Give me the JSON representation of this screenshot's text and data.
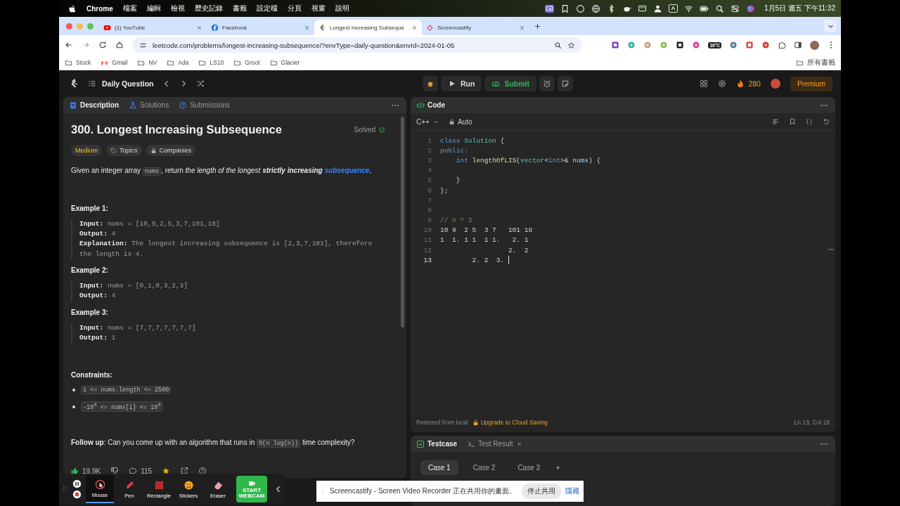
{
  "menubar": {
    "app": "Chrome",
    "menus": [
      "檔案",
      "編輯",
      "檢視",
      "歷史記錄",
      "書籤",
      "設定檔",
      "分頁",
      "視窗",
      "說明"
    ],
    "input_source": "A",
    "clock": "1月5日 週五  下午11:32"
  },
  "browser": {
    "tabs": [
      {
        "title": "(1) YouTube",
        "selected": false
      },
      {
        "title": "Facebook",
        "selected": false
      },
      {
        "title": "Longest Increasing Subseque",
        "selected": true
      },
      {
        "title": "Screencastify",
        "selected": false
      }
    ],
    "url": "leetcode.com/problems/longest-increasing-subsequence/?envType=daily-question&envId=2024-01-05",
    "weather_badge": "16°C",
    "bookmarks": [
      {
        "label": "Stock",
        "kind": "folder"
      },
      {
        "label": "Gmail",
        "kind": "mail"
      },
      {
        "label": "NV",
        "kind": "folder"
      },
      {
        "label": "Ada",
        "kind": "folder"
      },
      {
        "label": "LS10",
        "kind": "folder"
      },
      {
        "label": "Groot",
        "kind": "folder"
      },
      {
        "label": "Glacier",
        "kind": "folder"
      }
    ],
    "all_bookmarks": "所有書籤"
  },
  "header": {
    "list_title": "Daily Question",
    "run": "Run",
    "submit": "Submit",
    "streak": "280",
    "premium": "Premium"
  },
  "description": {
    "tabs": [
      {
        "label": "Description",
        "selected": true
      },
      {
        "label": "Solutions",
        "selected": false
      },
      {
        "label": "Submissions",
        "selected": false
      }
    ],
    "title": "300. Longest Increasing Subsequence",
    "status": "Solved",
    "tags": [
      {
        "label": "Medium",
        "kind": "difficulty"
      },
      {
        "label": "Topics",
        "kind": "topics"
      },
      {
        "label": "Companies",
        "kind": "companies"
      }
    ],
    "statement": [
      {
        "kind": "text",
        "text": "Given an integer array "
      },
      {
        "kind": "code",
        "text": "nums"
      },
      {
        "kind": "text",
        "text": ", return "
      },
      {
        "kind": "italic",
        "text": "the length of the longest "
      },
      {
        "kind": "bold_italic",
        "text": "strictly increasing "
      },
      {
        "kind": "link",
        "text": "subsequence"
      },
      {
        "kind": "text",
        "text": "."
      }
    ],
    "examples": [
      {
        "heading": "Example 1:",
        "lines": [
          {
            "label": "Input:",
            "value": "nums = [10,9,2,5,3,7,101,18]"
          },
          {
            "label": "Output:",
            "value": "4"
          },
          {
            "label": "Explanation:",
            "value": "The longest increasing subsequence is [2,3,7,101], therefore the length is 4."
          }
        ]
      },
      {
        "heading": "Example 2:",
        "lines": [
          {
            "label": "Input:",
            "value": "nums = [0,1,0,3,2,3]"
          },
          {
            "label": "Output:",
            "value": "4"
          }
        ]
      },
      {
        "heading": "Example 3:",
        "lines": [
          {
            "label": "Input:",
            "value": "nums = [7,7,7,7,7,7,7]"
          },
          {
            "label": "Output:",
            "value": "1"
          }
        ]
      }
    ],
    "constraints_heading": "Constraints:",
    "constraints": [
      "1 <= nums.length <= 2500",
      "-10$^{4}$ <= nums[i] <= 10$^{4}$"
    ],
    "follow_up": [
      {
        "kind": "bold",
        "text": "Follow up"
      },
      {
        "kind": "text",
        "text": ": Can you come up with an algorithm that runs in "
      },
      {
        "kind": "code",
        "text": "O(n log(n))"
      },
      {
        "kind": "text",
        "text": " time complexity?"
      }
    ],
    "likes": "19.9K",
    "comments": "115"
  },
  "code": {
    "title": "Code",
    "language": "C++",
    "mode": "Auto",
    "lines": [
      {
        "number": "1",
        "current": false,
        "tokens": [
          {
            "kind": "keyword",
            "text": "class"
          },
          {
            "kind": "type",
            "text": " Solution"
          },
          {
            "kind": "plain",
            "text": " {"
          }
        ]
      },
      {
        "number": "2",
        "current": false,
        "tokens": [
          {
            "kind": "keyword",
            "text": "public:"
          }
        ]
      },
      {
        "number": "3",
        "current": false,
        "tokens": [
          {
            "kind": "keyword",
            "text": "    int"
          },
          {
            "kind": "function",
            "text": " lengthOfLIS"
          },
          {
            "kind": "plain",
            "text": "("
          },
          {
            "kind": "type",
            "text": "vector"
          },
          {
            "kind": "plain",
            "text": "<"
          },
          {
            "kind": "keyword",
            "text": "int"
          },
          {
            "kind": "plain",
            "text": ">&"
          },
          {
            "kind": "variable",
            "text": " nums"
          },
          {
            "kind": "plain",
            "text": ") {"
          }
        ]
      },
      {
        "number": "4",
        "current": false
      },
      {
        "number": "5",
        "current": false,
        "tokens": [
          {
            "kind": "plain",
            "text": "    }"
          }
        ]
      },
      {
        "number": "6",
        "current": false,
        "tokens": [
          {
            "kind": "plain",
            "text": "};"
          }
        ]
      },
      {
        "number": "7",
        "current": false
      },
      {
        "number": "8",
        "current": false
      },
      {
        "number": "9",
        "current": false,
        "tokens": [
          {
            "kind": "comment",
            "text": "// n ^ 2"
          }
        ]
      },
      {
        "number": "10",
        "current": false,
        "tokens": [
          {
            "kind": "plain",
            "text": "10 9  2 5  3 7   101 18"
          }
        ]
      },
      {
        "number": "11",
        "current": false,
        "tokens": [
          {
            "kind": "plain",
            "text": "1  1. 1 1  1 1.   2. 1"
          }
        ]
      },
      {
        "number": "12",
        "current": false,
        "tokens": [
          {
            "kind": "plain",
            "text": "                 2.  2"
          }
        ]
      },
      {
        "number": "13",
        "current": true,
        "tokens": [
          {
            "kind": "plain",
            "text": "        2. 2  3. "
          }
        ]
      }
    ],
    "restored": "Restored from local",
    "upgrade": "Upgrade to Cloud Saving",
    "position": "Ln 13, Col 18"
  },
  "testcase": {
    "tabs": [
      {
        "label": "Testcase",
        "selected": true
      },
      {
        "label": "Test Result",
        "selected": false
      }
    ],
    "cases": [
      {
        "label": "Case 1",
        "selected": true
      },
      {
        "label": "Case 2",
        "selected": false
      },
      {
        "label": "Case 3",
        "selected": false
      }
    ]
  },
  "recorder": {
    "tools": [
      {
        "label": "Mouse",
        "selected": true
      },
      {
        "label": "Pen",
        "selected": false
      },
      {
        "label": "Rectangle",
        "selected": false
      },
      {
        "label": "Stickers",
        "selected": false
      },
      {
        "label": "Eraser",
        "selected": false
      }
    ],
    "webcam": "START WEBCAM"
  },
  "share_bar": {
    "message": "Screencastify - Screen Video Recorder 正在共用你的畫面。",
    "stop": "停止共用",
    "hide": "隱藏"
  }
}
